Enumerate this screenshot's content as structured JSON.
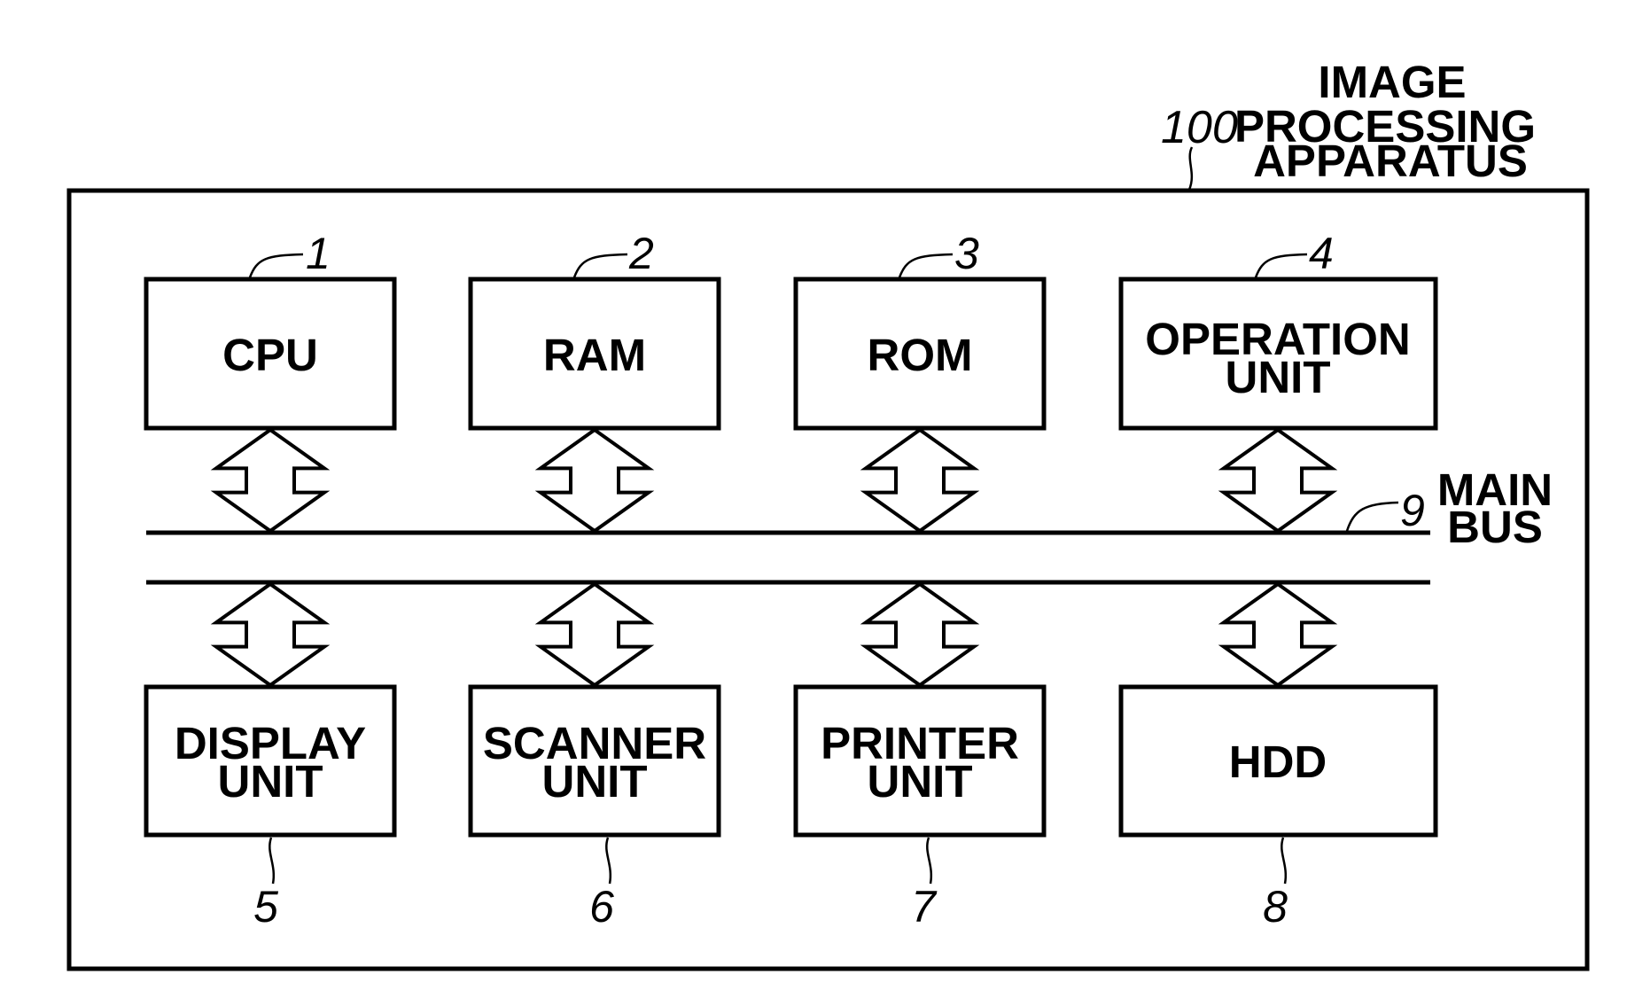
{
  "apparatus": {
    "ref": "100",
    "title_lines": [
      "IMAGE",
      "PROCESSING",
      "APPARATUS"
    ]
  },
  "bus": {
    "ref": "9",
    "label_lines": [
      "MAIN",
      "BUS"
    ]
  },
  "top_units": [
    {
      "ref": "1",
      "label_lines": [
        "CPU"
      ]
    },
    {
      "ref": "2",
      "label_lines": [
        "RAM"
      ]
    },
    {
      "ref": "3",
      "label_lines": [
        "ROM"
      ]
    },
    {
      "ref": "4",
      "label_lines": [
        "OPERATION",
        "UNIT"
      ]
    }
  ],
  "bottom_units": [
    {
      "ref": "5",
      "label_lines": [
        "DISPLAY",
        "UNIT"
      ]
    },
    {
      "ref": "6",
      "label_lines": [
        "SCANNER",
        "UNIT"
      ]
    },
    {
      "ref": "7",
      "label_lines": [
        "PRINTER",
        "UNIT"
      ]
    },
    {
      "ref": "8",
      "label_lines": [
        "HDD"
      ]
    }
  ],
  "colors": {
    "line": "#000000",
    "background": "#ffffff"
  }
}
